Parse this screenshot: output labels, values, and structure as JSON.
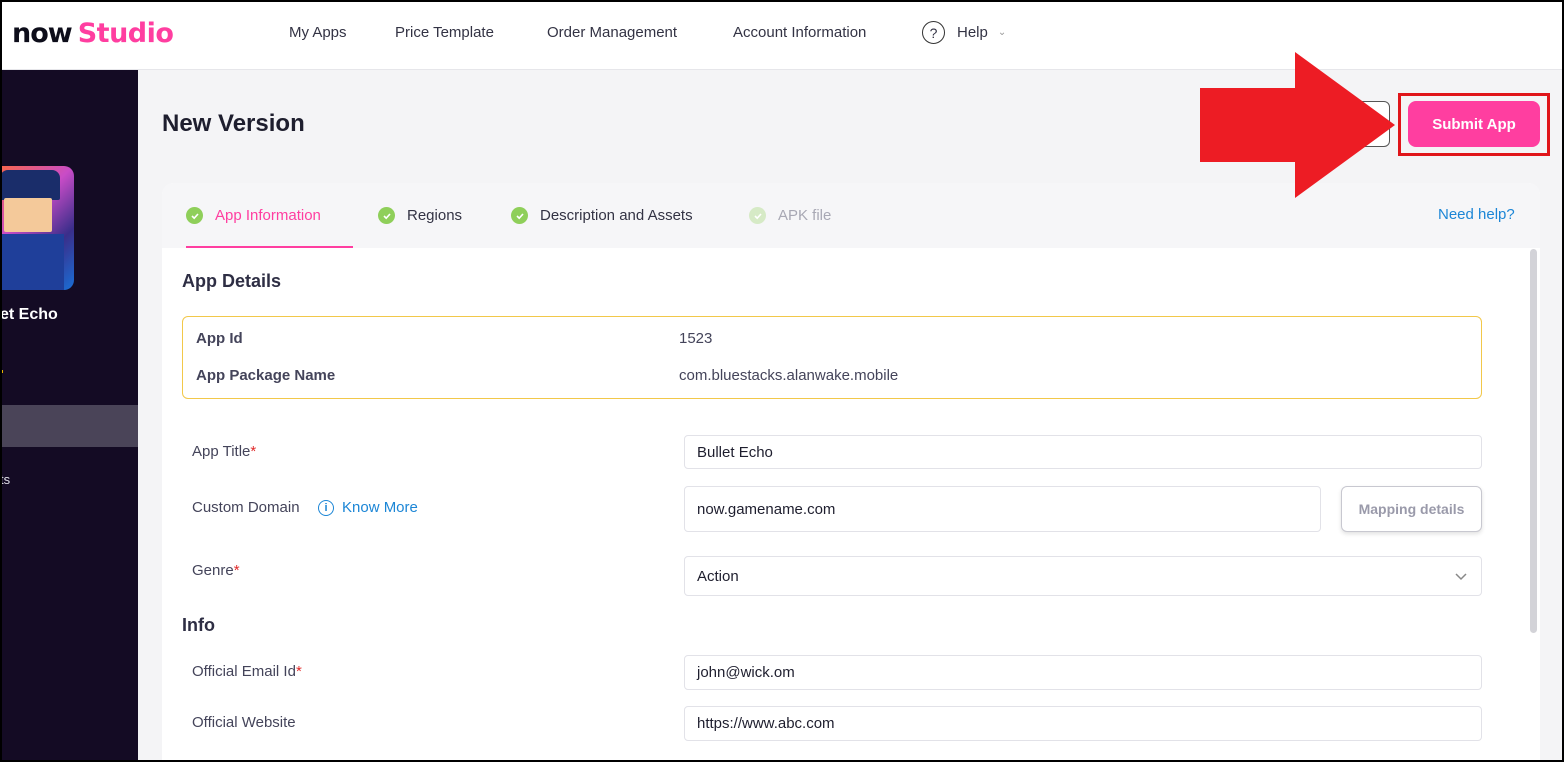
{
  "logo": {
    "now": "now",
    "studio": "Studio"
  },
  "nav": {
    "items": [
      "My Apps",
      "Price Template",
      "Order Management",
      "Account Information"
    ],
    "help_label": "Help",
    "help_glyph": "?"
  },
  "sidebar": {
    "app_name": "et Echo",
    "sub_item": "ts"
  },
  "page": {
    "title": "New Version",
    "submit_label": "Submit App"
  },
  "tabs": [
    {
      "label": "App Information",
      "state": "active"
    },
    {
      "label": "Regions",
      "state": "done"
    },
    {
      "label": "Description and Assets",
      "state": "done"
    },
    {
      "label": "APK file",
      "state": "disabled"
    }
  ],
  "need_help": "Need help?",
  "app_details": {
    "section_title": "App Details",
    "app_id_label": "App Id",
    "app_id_value": "1523",
    "package_label": "App Package Name",
    "package_value": "com.bluestacks.alanwake.mobile"
  },
  "form": {
    "app_title_label": "App Title",
    "app_title_value": "Bullet Echo",
    "custom_domain_label": "Custom Domain",
    "know_more": "Know More",
    "info_glyph": "i",
    "custom_domain_value": "now.gamename.com",
    "mapping_details": "Mapping details",
    "genre_label": "Genre",
    "genre_value": "Action",
    "required_mark": "*"
  },
  "info": {
    "section_title": "Info",
    "email_label": "Official Email Id",
    "email_value": "john@wick.om",
    "website_label": "Official Website",
    "website_value": "https://www.abc.com"
  },
  "colors": {
    "brand_pink": "#ff3ea0",
    "sidebar_bg": "#140b24",
    "check_green": "#8fcf5a",
    "link_blue": "#1c86d6",
    "annotation_red": "#e0151a"
  }
}
